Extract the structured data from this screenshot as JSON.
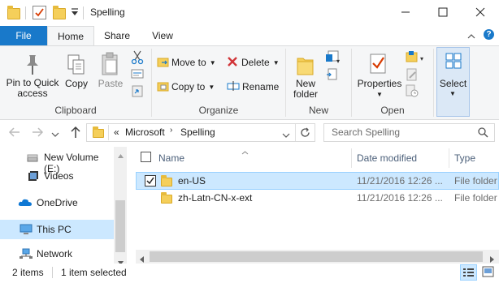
{
  "window": {
    "title": "Spelling"
  },
  "tabs": [
    {
      "label": "File"
    },
    {
      "label": "Home"
    },
    {
      "label": "Share"
    },
    {
      "label": "View"
    }
  ],
  "ribbon": {
    "clipboard": {
      "pin_label": "Pin to Quick access",
      "copy_label": "Copy",
      "paste_label": "Paste",
      "group_label": "Clipboard"
    },
    "organize": {
      "move_to_label": "Move to",
      "copy_to_label": "Copy to",
      "delete_label": "Delete",
      "rename_label": "Rename",
      "group_label": "Organize"
    },
    "new": {
      "new_folder_label": "New folder",
      "group_label": "New"
    },
    "open": {
      "properties_label": "Properties",
      "group_label": "Open"
    },
    "select": {
      "select_label": "Select"
    }
  },
  "address": {
    "overflow": "«",
    "crumbs": [
      "Microsoft",
      "Spelling"
    ]
  },
  "search": {
    "placeholder": "Search Spelling"
  },
  "nav_pane": {
    "items": [
      {
        "label": "New Volume (E:)",
        "icon": "drive-icon"
      },
      {
        "label": "Videos",
        "icon": "videos-icon"
      },
      {
        "label": "OneDrive",
        "icon": "onedrive-icon"
      },
      {
        "label": "This PC",
        "icon": "pc-icon",
        "selected": true
      },
      {
        "label": "Network",
        "icon": "network-icon"
      }
    ]
  },
  "file_list": {
    "columns": [
      "Name",
      "Date modified",
      "Type"
    ],
    "rows": [
      {
        "name": "en-US",
        "date": "11/21/2016 12:26 ...",
        "type": "File folder",
        "selected": true,
        "checked": true
      },
      {
        "name": "zh-Latn-CN-x-ext",
        "date": "11/21/2016 12:26 ...",
        "type": "File folder",
        "selected": false,
        "checked": false
      }
    ]
  },
  "status_bar": {
    "item_count": "2 items",
    "selection": "1 item selected"
  },
  "colors": {
    "file_tab": "#1979ca",
    "selection": "#cce8ff",
    "selection_border": "#99d1ff",
    "nav_selected": "#cce8ff",
    "folder": "#f5cf5a"
  }
}
